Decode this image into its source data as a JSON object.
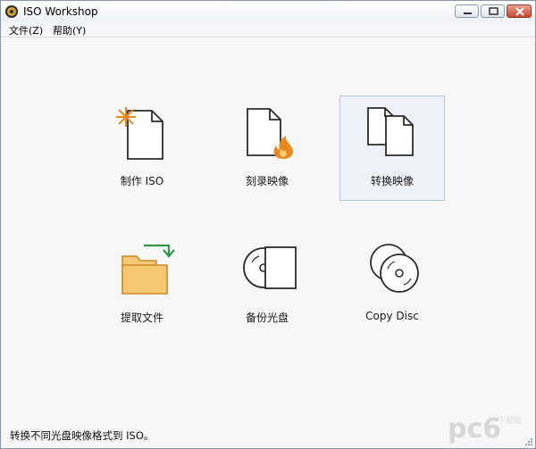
{
  "window": {
    "title": "ISO Workshop",
    "controls": {
      "minimize": "minimize",
      "maximize": "maximize",
      "close": "close"
    }
  },
  "menu": [
    {
      "label": "文件(Z)"
    },
    {
      "label": "帮助(Y)"
    }
  ],
  "tiles": [
    {
      "label": "制作 ISO",
      "icon": "make-iso-icon"
    },
    {
      "label": "刻录映像",
      "icon": "burn-image-icon"
    },
    {
      "label": "转换映像",
      "icon": "convert-image-icon",
      "selected": true
    },
    {
      "label": "提取文件",
      "icon": "extract-files-icon"
    },
    {
      "label": "备份光盘",
      "icon": "backup-disc-icon"
    },
    {
      "label": "Copy Disc",
      "icon": "copy-disc-icon"
    }
  ],
  "status": {
    "text": "转换不同光盘映像格式到 ISO。"
  },
  "watermark": {
    "text": "pc6",
    "subtext": "下载站"
  },
  "colors": {
    "accent_orange": "#e8881f",
    "folder": "#f3c978",
    "arrow_green": "#2e9a4a",
    "selection_bg": "#eef2f8"
  }
}
